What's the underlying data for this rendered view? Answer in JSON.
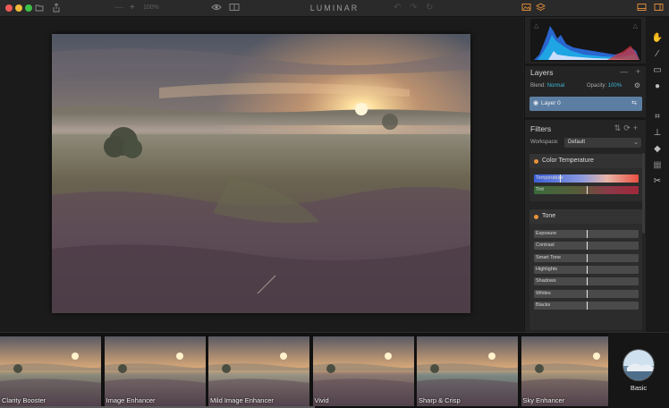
{
  "app": {
    "title": "LUMINAR",
    "zoom": "100%"
  },
  "titlebar": {
    "traffic_colors": [
      "#ee5b57",
      "#f2b93b",
      "#3cc245"
    ],
    "accent_orange": "#e8923a"
  },
  "histogram": {
    "warn_left": "△",
    "warn_right": "△"
  },
  "layers": {
    "title": "Layers",
    "minus": "—",
    "plus": "+",
    "blend_label": "Blend:",
    "blend_value": "Normal",
    "opacity_label": "Opacity:",
    "opacity_value": "100%",
    "items": [
      {
        "name": "Layer 0"
      }
    ]
  },
  "filters": {
    "title": "Filters",
    "workspace_label": "Workspace:",
    "workspace_value": "Default",
    "color_temperature": {
      "name": "Color Temperature",
      "sliders": [
        {
          "label": "Temperature",
          "value": 0.25
        },
        {
          "label": "Tint",
          "value": 0.5
        }
      ]
    },
    "tone": {
      "name": "Tone",
      "sliders": [
        {
          "label": "Exposure",
          "value": 0.5
        },
        {
          "label": "Contrast",
          "value": 0.5
        },
        {
          "label": "Smart Tone",
          "value": 0.5
        },
        {
          "label": "Highlights",
          "value": 0.5
        },
        {
          "label": "Shadows",
          "value": 0.5
        },
        {
          "label": "Whites",
          "value": 0.5
        },
        {
          "label": "Blacks",
          "value": 0.5
        }
      ]
    }
  },
  "presets": {
    "items": [
      {
        "name": "Clarity Booster"
      },
      {
        "name": "Image Enhancer"
      },
      {
        "name": "Mild Image Enhancer"
      },
      {
        "name": "Vivid"
      },
      {
        "name": "Sharp & Crisp"
      },
      {
        "name": "Sky Enhancer"
      }
    ],
    "category": "Basic"
  }
}
